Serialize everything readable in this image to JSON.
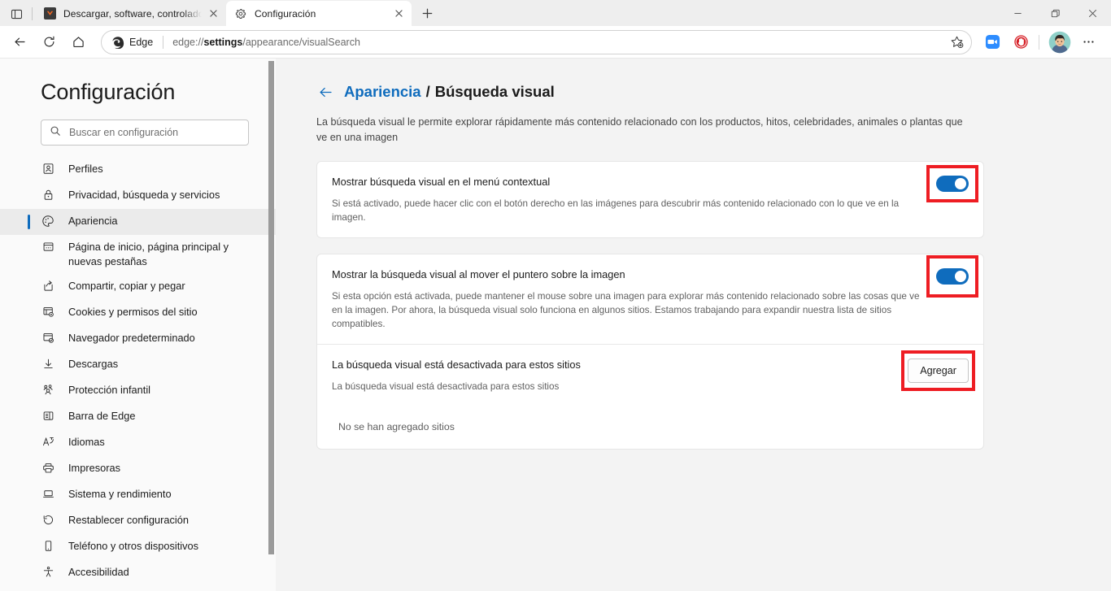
{
  "window": {
    "controls": {
      "minimize": "Minimizar",
      "restore": "Restaurar",
      "close": "Cerrar"
    }
  },
  "tabs": {
    "tab_search_label": "Búsqueda de pestañas",
    "new_tab_label": "Nueva pestaña",
    "items": [
      {
        "title": "Descargar, software, controlador",
        "favicon": "ninite-icon",
        "active": false,
        "close_label": "Cerrar pestaña"
      },
      {
        "title": "Configuración",
        "favicon": "gear-icon",
        "active": true,
        "close_label": "Cerrar pestaña"
      }
    ]
  },
  "toolbar": {
    "back_label": "Atrás",
    "refresh_label": "Actualizar",
    "home_label": "Inicio",
    "edge_chip_label": "Edge",
    "url": {
      "prefix": "edge://",
      "strong": "settings",
      "suffix": "/appearance/visualSearch"
    },
    "favorite_label": "Agregar esta página a favoritos",
    "extensions": [
      {
        "name": "zoom-extension-icon",
        "label": "Zoom",
        "color": "#2d8cff"
      },
      {
        "name": "adblock-extension-icon",
        "label": "AdBlock",
        "color": "#d61f26"
      }
    ],
    "avatar_label": "Perfil",
    "more_label": "Configuración y más"
  },
  "sidebar": {
    "title": "Configuración",
    "search": {
      "placeholder": "Buscar en configuración",
      "value": ""
    },
    "items": [
      {
        "label": "Perfiles",
        "icon": "profile-icon",
        "selected": false
      },
      {
        "label": "Privacidad, búsqueda y servicios",
        "icon": "lock-icon",
        "selected": false
      },
      {
        "label": "Apariencia",
        "icon": "palette-icon",
        "selected": true
      },
      {
        "label": "Página de inicio, página principal y nuevas pestañas",
        "icon": "startpage-icon",
        "selected": false
      },
      {
        "label": "Compartir, copiar y pegar",
        "icon": "share-icon",
        "selected": false
      },
      {
        "label": "Cookies y permisos del sitio",
        "icon": "cookies-icon",
        "selected": false
      },
      {
        "label": "Navegador predeterminado",
        "icon": "default-browser-icon",
        "selected": false
      },
      {
        "label": "Descargas",
        "icon": "download-icon",
        "selected": false
      },
      {
        "label": "Protección infantil",
        "icon": "family-icon",
        "selected": false
      },
      {
        "label": "Barra de Edge",
        "icon": "edge-bar-icon",
        "selected": false
      },
      {
        "label": "Idiomas",
        "icon": "language-icon",
        "selected": false
      },
      {
        "label": "Impresoras",
        "icon": "printer-icon",
        "selected": false
      },
      {
        "label": "Sistema y rendimiento",
        "icon": "system-icon",
        "selected": false
      },
      {
        "label": "Restablecer configuración",
        "icon": "reset-icon",
        "selected": false
      },
      {
        "label": "Teléfono y otros dispositivos",
        "icon": "phone-icon",
        "selected": false
      },
      {
        "label": "Accesibilidad",
        "icon": "accessibility-icon",
        "selected": false
      }
    ]
  },
  "main": {
    "breadcrumb": {
      "back_label": "Atrás",
      "parent": "Apariencia",
      "separator": "/",
      "current": "Búsqueda visual"
    },
    "intro": "La búsqueda visual le permite explorar rápidamente más contenido relacionado con los productos, hitos, celebridades, animales o plantas que ve en una imagen",
    "settings": [
      {
        "title": "Mostrar búsqueda visual en el menú contextual",
        "description": "Si está activado, puede hacer clic con el botón derecho en las imágenes para descubrir más contenido relacionado con lo que ve en la imagen.",
        "control": "toggle",
        "state": "on",
        "highlighted": true
      },
      {
        "title": "Mostrar la búsqueda visual al mover el puntero sobre la imagen",
        "description": "Si esta opción está activada, puede mantener el mouse sobre una imagen para explorar más contenido relacionado sobre las cosas que ve en la imagen. Por ahora, la búsqueda visual solo funciona en algunos sitios. Estamos trabajando para expandir nuestra lista de sitios compatibles.",
        "control": "toggle",
        "state": "on",
        "highlighted": true
      },
      {
        "title": "La búsqueda visual está desactivada para estos sitios",
        "description": "La búsqueda visual está desactivada para estos sitios",
        "control": "button",
        "button_label": "Agregar",
        "highlighted": true,
        "empty_text": "No se han agregado sitios"
      }
    ]
  },
  "colors": {
    "accent": "#0f6cbd",
    "highlight_red": "#ee1d23",
    "toggle_on": "#0f6cbd",
    "page_background": "#f3f3f3",
    "sidebar_background": "#fafafa"
  }
}
